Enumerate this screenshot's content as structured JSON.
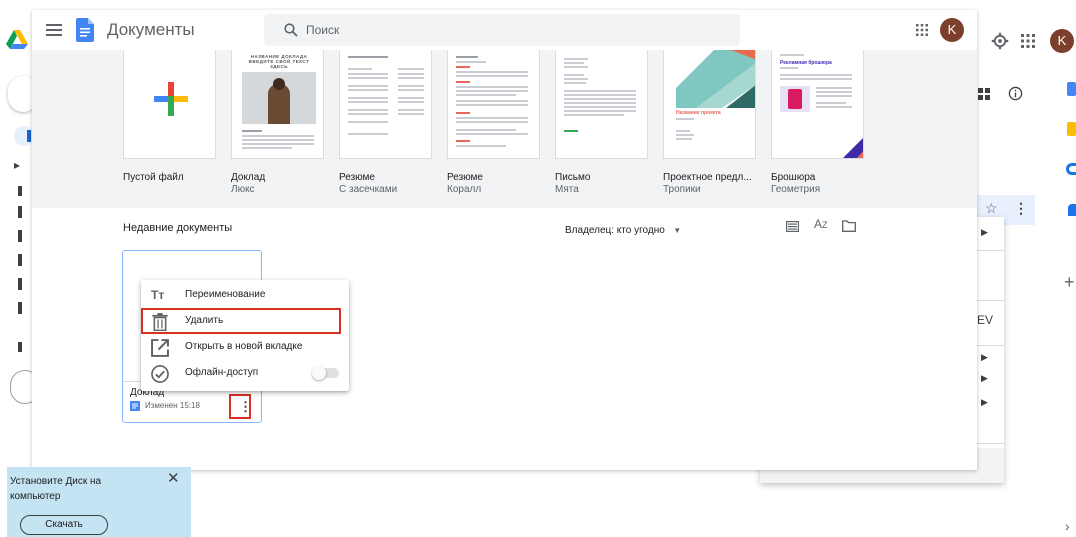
{
  "drive_bg": {
    "avatar_letter": "K",
    "right_partial_text": "EV",
    "add_symbol": "+",
    "scroll_symbol": "›"
  },
  "docs": {
    "app_title": "Документы",
    "search_placeholder": "Поиск",
    "avatar_letter": "K",
    "templates": [
      {
        "name": "Пустой файл",
        "sub": ""
      },
      {
        "name": "Доклад",
        "sub": "Люкс"
      },
      {
        "name": "Резюме",
        "sub": "С засечками"
      },
      {
        "name": "Резюме",
        "sub": "Коралл"
      },
      {
        "name": "Письмо",
        "sub": "Мята"
      },
      {
        "name": "Проектное предл...",
        "sub": "Тропики"
      },
      {
        "name": "Брошюра",
        "sub": "Геометрия"
      }
    ],
    "report_thumb_title": "НАЗВАНИЕ ДОКЛАДА ВВЕДИТЕ СВОЙ ТЕКСТ ЗДЕСЬ",
    "project_thumb_title": "Название проекта",
    "brochure_thumb_title": "Рекламная брошюра",
    "recent_title": "Недавние документы",
    "owner_filter": "Владелец: кто угодно",
    "doc": {
      "name": "Доклад",
      "modified": "Изменен 15:18"
    },
    "menu": {
      "rename": "Переименование",
      "delete": "Удалить",
      "open_new_tab": "Открыть в новой вкладке",
      "offline": "Офлайн-доступ",
      "rename_icon_text": "Tт"
    }
  },
  "toast": {
    "text_line1": "Установите Диск на",
    "text_line2": "компьютер",
    "download_label": "Скачать"
  },
  "colors": {
    "docs_blue": "#4285f4",
    "avatar_brown": "#7b3f2b",
    "highlight_red": "#d93025",
    "template_bg": "#f1f3f4",
    "toast_bg": "#c4e4f3"
  }
}
